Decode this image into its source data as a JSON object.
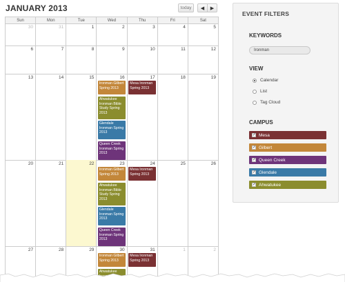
{
  "calendar": {
    "title": "JANUARY 2013",
    "today_label": "today",
    "prev_label": "◀",
    "next_label": "▶",
    "days_of_week": [
      "Sun",
      "Mon",
      "Tue",
      "Wed",
      "Thu",
      "Fri",
      "Sat"
    ],
    "weeks": [
      {
        "dates": [
          "30",
          "31",
          "1",
          "2",
          "3",
          "4",
          "5"
        ],
        "other_month": [
          true,
          true,
          false,
          false,
          false,
          false,
          false
        ],
        "today": [
          false,
          false,
          false,
          false,
          false,
          false,
          false
        ]
      },
      {
        "dates": [
          "6",
          "7",
          "8",
          "9",
          "10",
          "11",
          "12"
        ],
        "other_month": [
          false,
          false,
          false,
          false,
          false,
          false,
          false
        ],
        "today": [
          false,
          false,
          false,
          false,
          false,
          false,
          false
        ]
      },
      {
        "dates": [
          "13",
          "14",
          "15",
          "16",
          "17",
          "18",
          "19"
        ],
        "other_month": [
          false,
          false,
          false,
          false,
          false,
          false,
          false
        ],
        "today": [
          false,
          false,
          false,
          false,
          false,
          false,
          false
        ]
      },
      {
        "dates": [
          "20",
          "21",
          "22",
          "23",
          "24",
          "25",
          "26"
        ],
        "other_month": [
          false,
          false,
          false,
          false,
          false,
          false,
          false
        ],
        "today": [
          false,
          false,
          true,
          false,
          false,
          false,
          false
        ]
      },
      {
        "dates": [
          "27",
          "28",
          "29",
          "30",
          "31",
          "1",
          "2"
        ],
        "other_month": [
          false,
          false,
          false,
          false,
          false,
          true,
          true
        ],
        "today": [
          false,
          false,
          false,
          false,
          false,
          false,
          false
        ]
      }
    ],
    "events": [
      {
        "week": 2,
        "day": 3,
        "slot": 0,
        "title": "Ironman Gilbert Spring 2013",
        "campus": "gilbert"
      },
      {
        "week": 2,
        "day": 4,
        "slot": 0,
        "title": "Mesa Ironman Spring 2013",
        "campus": "mesa"
      },
      {
        "week": 2,
        "day": 3,
        "slot": 1,
        "title": "Ahwatukee Ironman Bible Study Spring 2013",
        "campus": "ahwa"
      },
      {
        "week": 2,
        "day": 3,
        "slot": 2,
        "title": "Glendale Ironman Spring 2013",
        "campus": "glendale"
      },
      {
        "week": 2,
        "day": 3,
        "slot": 3,
        "title": "Queen Creek Ironman Spring 2013",
        "campus": "queen"
      },
      {
        "week": 3,
        "day": 3,
        "slot": 0,
        "title": "Ironman Gilbert Spring 2013",
        "campus": "gilbert"
      },
      {
        "week": 3,
        "day": 4,
        "slot": 0,
        "title": "Mesa Ironman Spring 2013",
        "campus": "mesa"
      },
      {
        "week": 3,
        "day": 3,
        "slot": 1,
        "title": "Ahwatukee Ironman Bible Study Spring 2013",
        "campus": "ahwa"
      },
      {
        "week": 3,
        "day": 3,
        "slot": 2,
        "title": "Glendale Ironman Spring 2013",
        "campus": "glendale"
      },
      {
        "week": 3,
        "day": 3,
        "slot": 3,
        "title": "Queen Creek Ironman Spring 2013",
        "campus": "queen"
      },
      {
        "week": 4,
        "day": 3,
        "slot": 0,
        "title": "Ironman Gilbert Spring 2013",
        "campus": "gilbert"
      },
      {
        "week": 4,
        "day": 4,
        "slot": 0,
        "title": "Mesa Ironman Spring 2013",
        "campus": "mesa"
      },
      {
        "week": 4,
        "day": 3,
        "slot": 1,
        "title": "Ahwatukee Ironman",
        "campus": "ahwa"
      }
    ]
  },
  "filters": {
    "title": "EVENT FILTERS",
    "keywords_title": "KEYWORDS",
    "keyword_value": "Ironman",
    "view_title": "VIEW",
    "view_options": [
      {
        "label": "Calendar",
        "selected": true
      },
      {
        "label": "List",
        "selected": false
      },
      {
        "label": "Tag Cloud",
        "selected": false
      }
    ],
    "campus_title": "CAMPUS",
    "campuses": [
      {
        "label": "Mesa",
        "key": "mesa",
        "checked": true
      },
      {
        "label": "Gilbert",
        "key": "gilbert",
        "checked": true
      },
      {
        "label": "Queen Creek",
        "key": "queen",
        "checked": true
      },
      {
        "label": "Glendale",
        "key": "glendale",
        "checked": true
      },
      {
        "label": "Ahwatukee",
        "key": "ahwa",
        "checked": true
      }
    ],
    "check_mark": "✓"
  },
  "colors": {
    "mesa": "#7a3133",
    "gilbert": "#c3873a",
    "queen_creek": "#6e347a",
    "glendale": "#3a7aa7",
    "ahwatukee": "#8b8d2e",
    "today_highlight": "#fcf8d0"
  }
}
